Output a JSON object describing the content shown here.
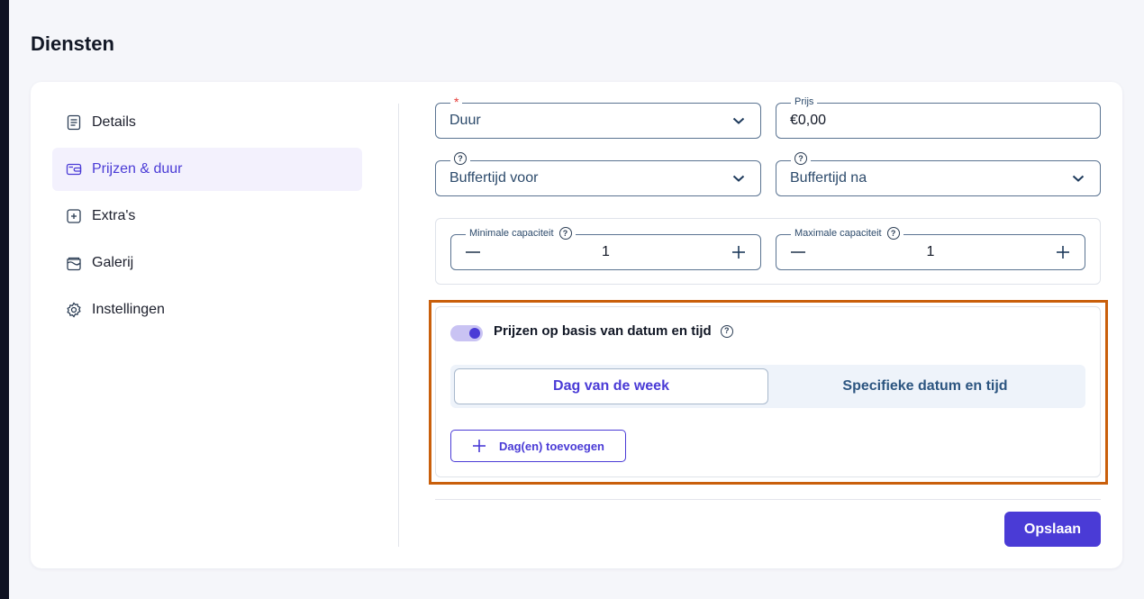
{
  "page": {
    "title": "Diensten"
  },
  "sidebar": {
    "items": [
      {
        "label": "Details",
        "icon": "document-icon",
        "active": false
      },
      {
        "label": "Prijzen & duur",
        "icon": "wallet-icon",
        "active": true
      },
      {
        "label": "Extra's",
        "icon": "plus-square-icon",
        "active": false
      },
      {
        "label": "Galerij",
        "icon": "gallery-icon",
        "active": false
      },
      {
        "label": "Instellingen",
        "icon": "gear-icon",
        "active": false
      }
    ]
  },
  "form": {
    "duration": {
      "required_mark": "*",
      "placeholder": "Duur"
    },
    "price": {
      "label": "Prijs",
      "value": "€0,00"
    },
    "buffer_before": {
      "help": "?",
      "placeholder": "Buffertijd voor"
    },
    "buffer_after": {
      "help": "?",
      "placeholder": "Buffertijd na"
    },
    "min_capacity": {
      "label": "Minimale capaciteit",
      "help": "?",
      "value": "1"
    },
    "max_capacity": {
      "label": "Maximale capaciteit",
      "help": "?",
      "value": "1"
    }
  },
  "pricing": {
    "toggle_label": "Prijzen op basis van datum en tijd",
    "toggle_on": true,
    "help": "?",
    "tabs": [
      {
        "label": "Dag van de week",
        "active": true
      },
      {
        "label": "Specifieke datum en tijd",
        "active": false
      }
    ],
    "add_button_label": "Dag(en) toevoegen"
  },
  "actions": {
    "save_label": "Opslaan"
  },
  "colors": {
    "accent": "#4a3bd6",
    "highlight_border": "#c95f0b",
    "field_border": "#5a7391"
  }
}
